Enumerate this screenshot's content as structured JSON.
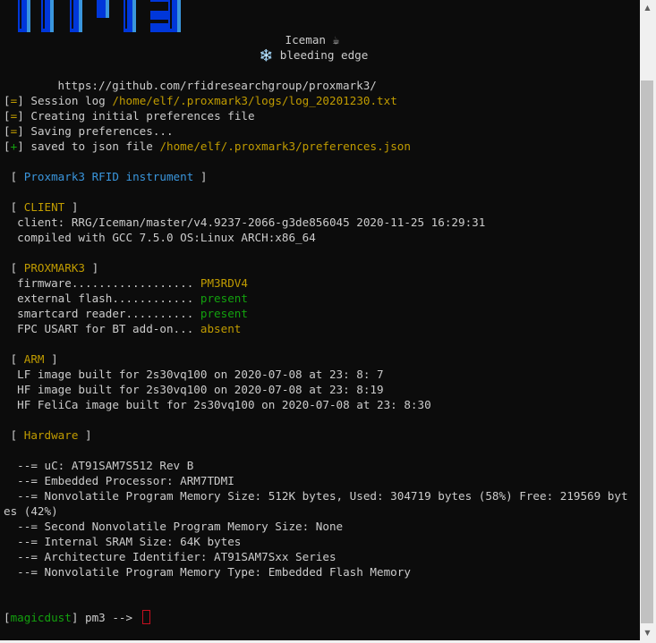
{
  "banner": {
    "product": "Iceman ☕",
    "channel": "❄️ bleeding edge",
    "url": "https://github.com/rfidresearchgroup/proxmark3/"
  },
  "log": [
    {
      "tag": "=",
      "text": " Session log ",
      "path": "/home/elf/.proxmark3/logs/log_20201230.txt"
    },
    {
      "tag": "=",
      "text": " Creating initial preferences file",
      "path": ""
    },
    {
      "tag": "=",
      "text": " Saving preferences...",
      "path": ""
    },
    {
      "tag": "+",
      "text": " saved to json file ",
      "path": "/home/elf/.proxmark3/preferences.json"
    }
  ],
  "instrument_title": "Proxmark3 RFID instrument",
  "client": {
    "title": "CLIENT",
    "line1": "  client: RRG/Iceman/master/v4.9237-2066-g3de856045 2020-11-25 16:29:31",
    "line2": "  compiled with GCC 7.5.0 OS:Linux ARCH:x86_64"
  },
  "proxmark3": {
    "title": "PROXMARK3",
    "rows": [
      {
        "label": "  firmware.................. ",
        "value": "PM3RDV4",
        "color": "#c19c00"
      },
      {
        "label": "  external flash............ ",
        "value": "present",
        "color": "#13a10e"
      },
      {
        "label": "  smartcard reader.......... ",
        "value": "present",
        "color": "#13a10e"
      },
      {
        "label": "  FPC USART for BT add-on... ",
        "value": "absent",
        "color": "#c19c00"
      }
    ]
  },
  "arm": {
    "title": "ARM",
    "lines": [
      "  LF image built for 2s30vq100 on 2020-07-08 at 23: 8: 7",
      "  HF image built for 2s30vq100 on 2020-07-08 at 23: 8:19",
      "  HF FeliCa image built for 2s30vq100 on 2020-07-08 at 23: 8:30"
    ]
  },
  "hardware": {
    "title": "Hardware",
    "lines": [
      "  --= uC: AT91SAM7S512 Rev B",
      "  --= Embedded Processor: ARM7TDMI",
      "  --= Nonvolatile Program Memory Size: 512K bytes, Used: 304719 bytes (58%) Free: 219569 byt",
      "es (42%)",
      "  --= Second Nonvolatile Program Memory Size: None",
      "  --= Internal SRAM Size: 64K bytes",
      "  --= Architecture Identifier: AT91SAM7Sxx Series",
      "  --= Nonvolatile Program Memory Type: Embedded Flash Memory"
    ]
  },
  "prompt": {
    "user": "magicdust",
    "text": " pm3 --> "
  },
  "colors": {
    "background": "#0c0c0c",
    "text": "#cccccc",
    "accent_yellow": "#c19c00",
    "accent_cyan": "#3a96dd",
    "accent_green": "#13a10e",
    "cursor_red": "#c50f1f"
  },
  "icons": [
    "proxmark3-logo",
    "coffee-icon",
    "snowflake-icon",
    "scroll-up-icon",
    "scroll-down-icon"
  ]
}
